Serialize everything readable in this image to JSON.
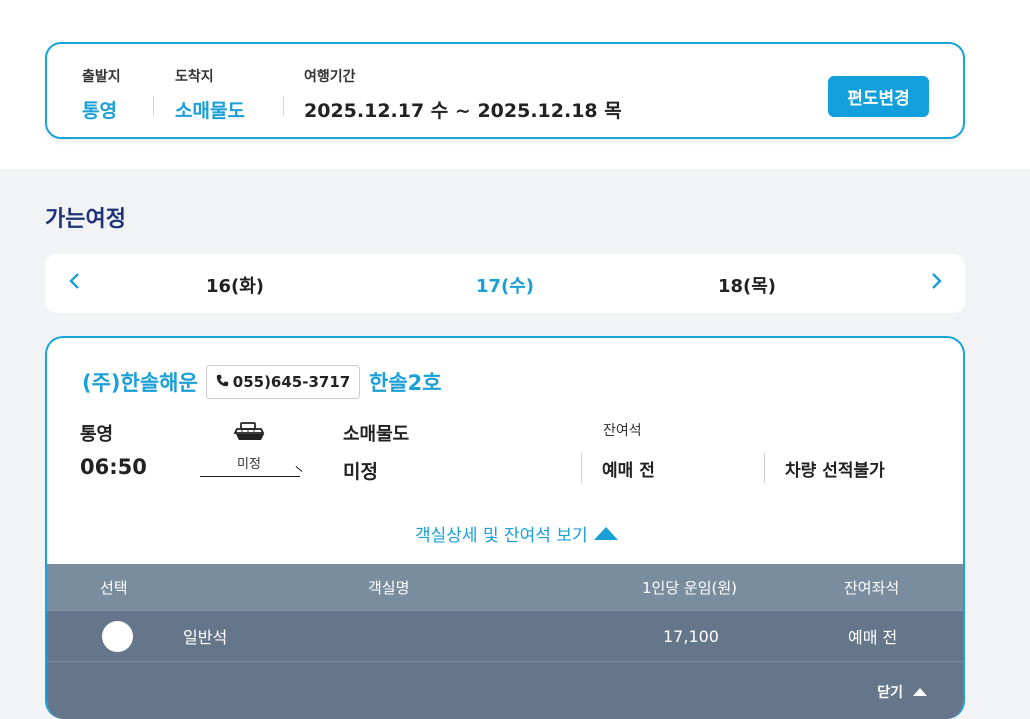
{
  "search": {
    "departure_label": "출발지",
    "departure_value": "통영",
    "arrival_label": "도착지",
    "arrival_value": "소매물도",
    "period_label": "여행기간",
    "period_value": "2025.12.17 수 ~ 2025.12.18 목",
    "change_button": "편도변경"
  },
  "section_title": "가는여정",
  "dates": {
    "prev_icon": "chevron-left",
    "next_icon": "chevron-right",
    "items": [
      "16(화)",
      "17(수)",
      "18(목)"
    ],
    "active_index": 1
  },
  "trip": {
    "company": "(주)한솔해운",
    "phone": "055)645-3717",
    "ship_name": "한솔2호",
    "from_port": "통영",
    "from_time": "06:50",
    "route_status": "미정",
    "to_port": "소매물도",
    "to_time": "미정",
    "remaining_label": "잔여석",
    "passenger_status": "예매 전",
    "vehicle_status": "차량 선적불가",
    "detail_link": "객실상세 및 잔여석 보기"
  },
  "room_table": {
    "headers": [
      "선택",
      "객실명",
      "1인당 운임(원)",
      "잔여좌석"
    ],
    "rows": [
      {
        "name": "일반석",
        "fare": "17,100",
        "remaining": "예매 전"
      }
    ],
    "close_label": "닫기"
  },
  "colors": {
    "accent": "#1a9fd6",
    "title": "#1f3478",
    "table_head": "#7a8d9f",
    "table_row": "#66768a"
  }
}
